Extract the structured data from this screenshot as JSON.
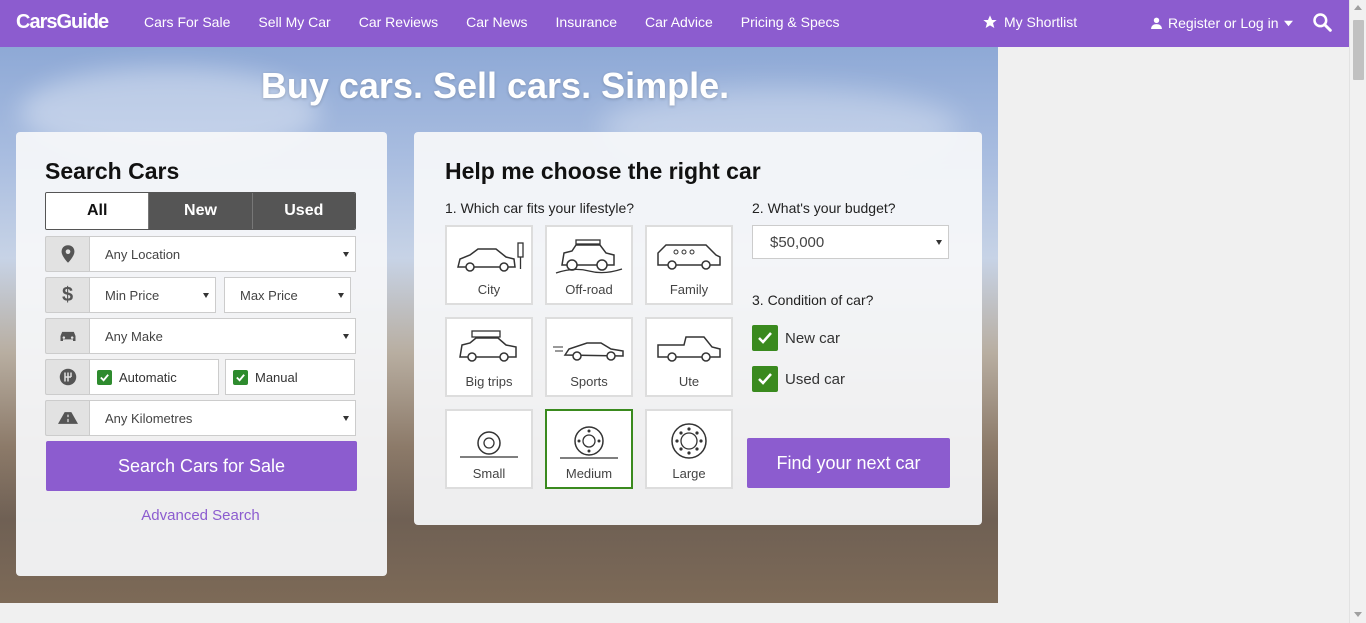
{
  "nav": {
    "logo_a": "Cars",
    "logo_b": "Guide",
    "links": [
      "Cars For Sale",
      "Sell My Car",
      "Car Reviews",
      "Car News",
      "Insurance",
      "Car Advice",
      "Pricing & Specs"
    ],
    "shortlist": "My Shortlist",
    "register": "Register or Log in"
  },
  "hero": {
    "headline": "Buy cars. Sell cars. Simple."
  },
  "search": {
    "title": "Search Cars",
    "tabs": [
      "All",
      "New",
      "Used"
    ],
    "location": "Any Location",
    "min_price": "Min Price",
    "max_price": "Max Price",
    "make": "Any Make",
    "automatic": "Automatic",
    "manual": "Manual",
    "kilometres": "Any Kilometres",
    "submit": "Search Cars for Sale",
    "advanced": "Advanced Search"
  },
  "chooser": {
    "title": "Help me choose the right car",
    "q1": "1. Which car fits your lifestyle?",
    "q2": "2. What's your budget?",
    "q3": "3. Condition of car?",
    "tiles": [
      "City",
      "Off-road",
      "Family",
      "Big trips",
      "Sports",
      "Ute",
      "Small",
      "Medium",
      "Large"
    ],
    "budget": "$50,000",
    "new_car": "New car",
    "used_car": "Used car",
    "submit": "Find your next car"
  },
  "colors": {
    "brand": "#8c5ccf",
    "check": "#3a8a1e"
  }
}
